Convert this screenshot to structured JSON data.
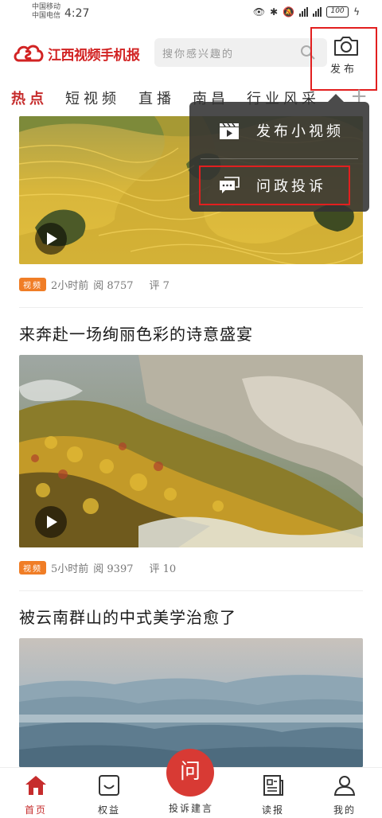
{
  "status_bar": {
    "carrier_1": "中国移动",
    "carrier_2": "中国电信",
    "time": "4:27",
    "battery": "100"
  },
  "header": {
    "app_name": "江西视频手机报",
    "search_placeholder": "搜你感兴趣的",
    "publish_label": "发布"
  },
  "tabs": [
    {
      "label": "热点",
      "active": true
    },
    {
      "label": "短视频"
    },
    {
      "label": "直播"
    },
    {
      "label": "南昌"
    },
    {
      "label": "行业风采"
    }
  ],
  "popup": {
    "items": [
      {
        "label": "发布小视频",
        "icon": "video-clapper-icon"
      },
      {
        "label": "问政投诉",
        "icon": "chat-bubbles-icon"
      }
    ]
  },
  "feed": [
    {
      "title": "",
      "tag": "视频",
      "time": "2小时前",
      "views": "阅 8757",
      "comments": "评 7"
    },
    {
      "title": "来奔赴一场绚丽色彩的诗意盛宴",
      "tag": "视频",
      "time": "5小时前",
      "views": "阅 9397",
      "comments": "评 10"
    },
    {
      "title": "被云南群山的中式美学治愈了"
    }
  ],
  "bottom_nav": {
    "items": [
      {
        "label": "首页",
        "icon": "home-icon",
        "active": true
      },
      {
        "label": "权益",
        "icon": "smile-box-icon"
      },
      {
        "label": "投诉建言",
        "icon": "ask-icon",
        "glyph": "问"
      },
      {
        "label": "读报",
        "icon": "newspaper-icon"
      },
      {
        "label": "我的",
        "icon": "person-icon"
      }
    ]
  },
  "colors": {
    "brand_red": "#d22323",
    "tab_active": "#c62c2c",
    "tag_orange": "#f07d26",
    "highlight_box": "#e21f1f"
  }
}
